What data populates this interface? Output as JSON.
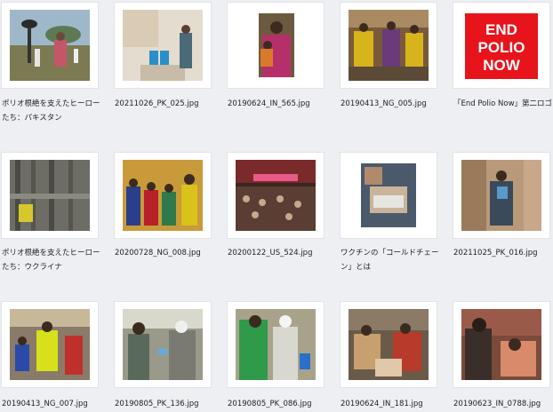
{
  "items": [
    {
      "name": "ポリオ根絶を支えたヒーロー\nたち：パキスタン",
      "kind": "image"
    },
    {
      "name": "20211026_PK_025.jpg",
      "kind": "image"
    },
    {
      "name": "20190624_IN_565.jpg",
      "kind": "image"
    },
    {
      "name": "20190413_NG_005.jpg",
      "kind": "image"
    },
    {
      "name": "「End Polio Now」第二ロゴ",
      "kind": "logo",
      "logo_lines": [
        "END",
        "POLIO",
        "NOW"
      ],
      "logo_color": "#e8141b"
    },
    {
      "name": "ポリオ根絶を支えたヒーロー\nたち：ウクライナ",
      "kind": "image"
    },
    {
      "name": "20200728_NG_008.jpg",
      "kind": "image"
    },
    {
      "name": "20200122_US_524.jpg",
      "kind": "image"
    },
    {
      "name": "ワクチンの「コールドチェー\nン」とは",
      "kind": "image"
    },
    {
      "name": "20211025_PK_016.jpg",
      "kind": "image"
    },
    {
      "name": "20190413_NG_007.jpg",
      "kind": "image"
    },
    {
      "name": "20190805_PK_136.jpg",
      "kind": "image"
    },
    {
      "name": "20190805_PK_086.jpg",
      "kind": "image"
    },
    {
      "name": "20190624_IN_181.jpg",
      "kind": "image"
    },
    {
      "name": "20190623_IN_0788.jpg",
      "kind": "image"
    }
  ]
}
